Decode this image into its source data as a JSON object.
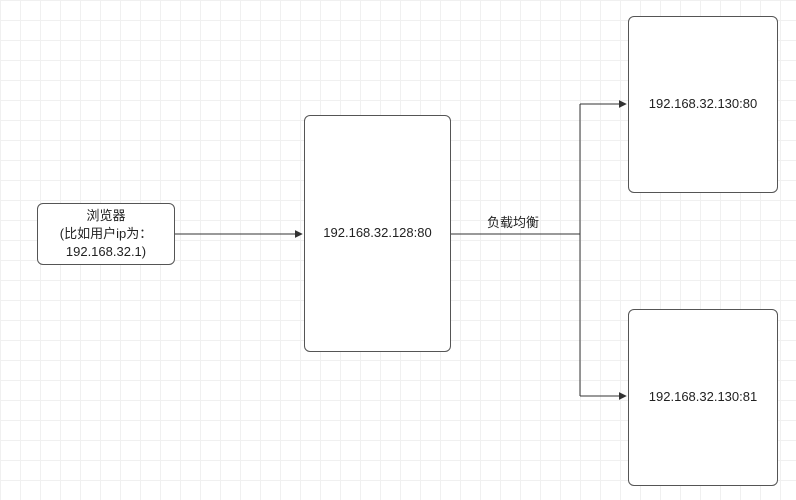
{
  "nodes": {
    "browser": {
      "line1": "浏览器",
      "line2": "(比如用户ip为：",
      "line3": "192.168.32.1)"
    },
    "proxy": {
      "label": "192.168.32.128:80"
    },
    "server1": {
      "label": "192.168.32.130:80"
    },
    "server2": {
      "label": "192.168.32.130:81"
    }
  },
  "edges": {
    "proxy_to_servers_label": "负载均衡"
  }
}
